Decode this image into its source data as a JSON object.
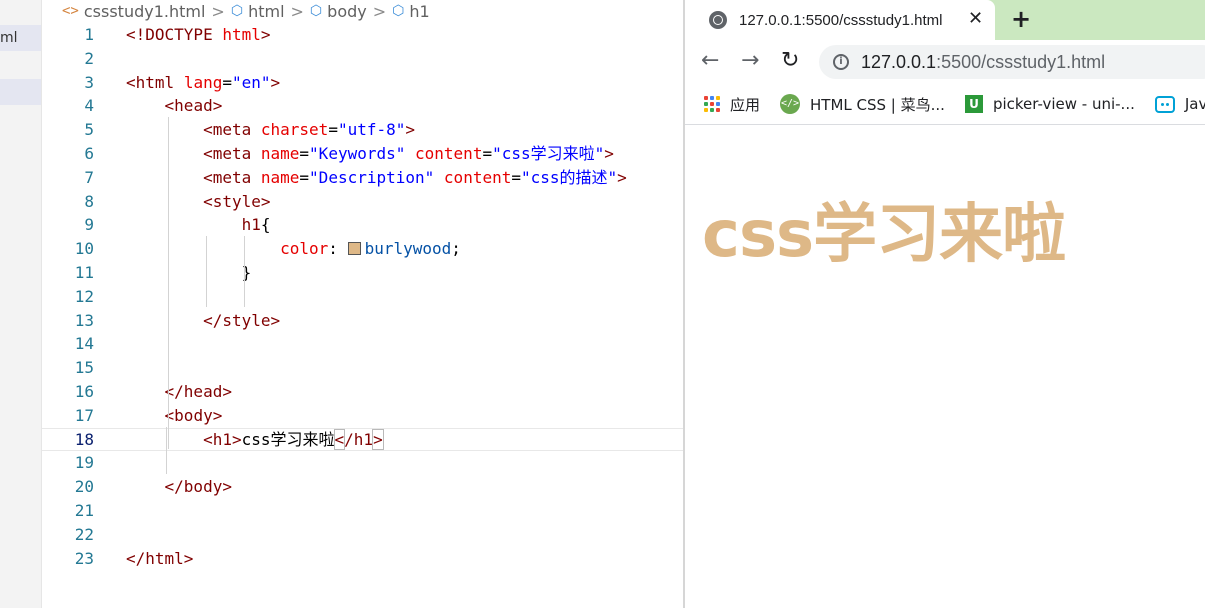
{
  "colors": {
    "h1_color": "#deb887",
    "tab_bar": "#cbe8c0"
  },
  "sidebar": {
    "file_label": "ml"
  },
  "breadcrumb": {
    "items": [
      {
        "label": "cssstudy1.html",
        "icon": "html-file-icon"
      },
      {
        "label": "html",
        "icon": "element-cube-icon"
      },
      {
        "label": "body",
        "icon": "element-cube-icon"
      },
      {
        "label": "h1",
        "icon": "element-cube-icon"
      }
    ],
    "separator": ">"
  },
  "editor": {
    "current_line": 18,
    "lines": [
      {
        "n": "1",
        "tokens": [
          [
            "dt",
            "<!DOCTYPE "
          ],
          [
            "dtk",
            "html"
          ],
          [
            "dt",
            ">"
          ]
        ]
      },
      {
        "n": "2",
        "tokens": []
      },
      {
        "n": "3",
        "tokens": [
          [
            "punc",
            "<"
          ],
          [
            "tag",
            "html"
          ],
          [
            "text",
            " "
          ],
          [
            "attr",
            "lang"
          ],
          [
            "eq",
            "="
          ],
          [
            "val",
            "\"en\""
          ],
          [
            "punc",
            ">"
          ]
        ]
      },
      {
        "n": "4",
        "tokens": [
          [
            "text",
            "    "
          ],
          [
            "punc",
            "<"
          ],
          [
            "tag",
            "head"
          ],
          [
            "punc",
            ">"
          ]
        ]
      },
      {
        "n": "5",
        "tokens": [
          [
            "text",
            "        "
          ],
          [
            "punc",
            "<"
          ],
          [
            "tag",
            "meta"
          ],
          [
            "text",
            " "
          ],
          [
            "attr",
            "charset"
          ],
          [
            "eq",
            "="
          ],
          [
            "val",
            "\"utf-8\""
          ],
          [
            "punc",
            ">"
          ]
        ]
      },
      {
        "n": "6",
        "tokens": [
          [
            "text",
            "        "
          ],
          [
            "punc",
            "<"
          ],
          [
            "tag",
            "meta"
          ],
          [
            "text",
            " "
          ],
          [
            "attr",
            "name"
          ],
          [
            "eq",
            "="
          ],
          [
            "val",
            "\"Keywords\""
          ],
          [
            "text",
            " "
          ],
          [
            "attr",
            "content"
          ],
          [
            "eq",
            "="
          ],
          [
            "val",
            "\"css学习来啦\""
          ],
          [
            "punc",
            ">"
          ]
        ]
      },
      {
        "n": "7",
        "tokens": [
          [
            "text",
            "        "
          ],
          [
            "punc",
            "<"
          ],
          [
            "tag",
            "meta"
          ],
          [
            "text",
            " "
          ],
          [
            "attr",
            "name"
          ],
          [
            "eq",
            "="
          ],
          [
            "val",
            "\"Description\""
          ],
          [
            "text",
            " "
          ],
          [
            "attr",
            "content"
          ],
          [
            "eq",
            "="
          ],
          [
            "val",
            "\"css的描述\""
          ],
          [
            "punc",
            ">"
          ]
        ]
      },
      {
        "n": "8",
        "tokens": [
          [
            "text",
            "        "
          ],
          [
            "punc",
            "<"
          ],
          [
            "tag",
            "style"
          ],
          [
            "punc",
            ">"
          ]
        ]
      },
      {
        "n": "9",
        "tokens": [
          [
            "text",
            "            "
          ],
          [
            "tag",
            "h1"
          ],
          [
            "text",
            "{"
          ]
        ]
      },
      {
        "n": "10",
        "tokens": [
          [
            "text",
            "                "
          ],
          [
            "prop",
            "color"
          ],
          [
            "text",
            ": "
          ],
          [
            "swatch",
            ""
          ],
          [
            "pv",
            "burlywood"
          ],
          [
            "text",
            ";"
          ]
        ]
      },
      {
        "n": "11",
        "tokens": [
          [
            "text",
            "            }"
          ]
        ]
      },
      {
        "n": "12",
        "tokens": []
      },
      {
        "n": "13",
        "tokens": [
          [
            "text",
            "        "
          ],
          [
            "punc",
            "</"
          ],
          [
            "tag",
            "style"
          ],
          [
            "punc",
            ">"
          ]
        ]
      },
      {
        "n": "14",
        "tokens": []
      },
      {
        "n": "15",
        "tokens": []
      },
      {
        "n": "16",
        "tokens": [
          [
            "text",
            "    "
          ],
          [
            "punc",
            "</"
          ],
          [
            "tag",
            "head"
          ],
          [
            "punc",
            ">"
          ]
        ]
      },
      {
        "n": "17",
        "tokens": [
          [
            "text",
            "    "
          ],
          [
            "punc",
            "<"
          ],
          [
            "tag",
            "body"
          ],
          [
            "punc",
            ">"
          ]
        ]
      },
      {
        "n": "18",
        "tokens": [
          [
            "text",
            "        "
          ],
          [
            "punc",
            "<"
          ],
          [
            "tag",
            "h1"
          ],
          [
            "punc",
            ">"
          ],
          [
            "text",
            "css学习来啦"
          ],
          [
            "hl",
            "<"
          ],
          [
            "punc",
            "/"
          ],
          [
            "tag",
            "h1"
          ],
          [
            "hl",
            ">"
          ]
        ]
      },
      {
        "n": "19",
        "tokens": []
      },
      {
        "n": "20",
        "tokens": [
          [
            "text",
            "    "
          ],
          [
            "punc",
            "</"
          ],
          [
            "tag",
            "body"
          ],
          [
            "punc",
            ">"
          ]
        ]
      },
      {
        "n": "21",
        "tokens": []
      },
      {
        "n": "22",
        "tokens": []
      },
      {
        "n": "23",
        "tokens": [
          [
            "punc",
            "</"
          ],
          [
            "tag",
            "html"
          ],
          [
            "punc",
            ">"
          ]
        ]
      }
    ]
  },
  "browser": {
    "tab": {
      "title": "127.0.0.1:5500/cssstudy1.html",
      "close": "✕",
      "icon": "globe-icon"
    },
    "new_tab": "+",
    "nav": {
      "back": "←",
      "forward": "→",
      "reload": "↻"
    },
    "url": {
      "host": "127.0.0.1",
      "rest": ":5500/cssstudy1.html"
    },
    "bookmarks": [
      {
        "label": "应用",
        "icon": "apps-grid-icon"
      },
      {
        "label": "HTML CSS | 菜鸟...",
        "icon": "runoob-icon"
      },
      {
        "label": "picker-view - uni-...",
        "icon": "uniapp-icon"
      },
      {
        "label": "Java",
        "icon": "bilibili-icon"
      }
    ],
    "page": {
      "heading": "css学习来啦"
    }
  }
}
